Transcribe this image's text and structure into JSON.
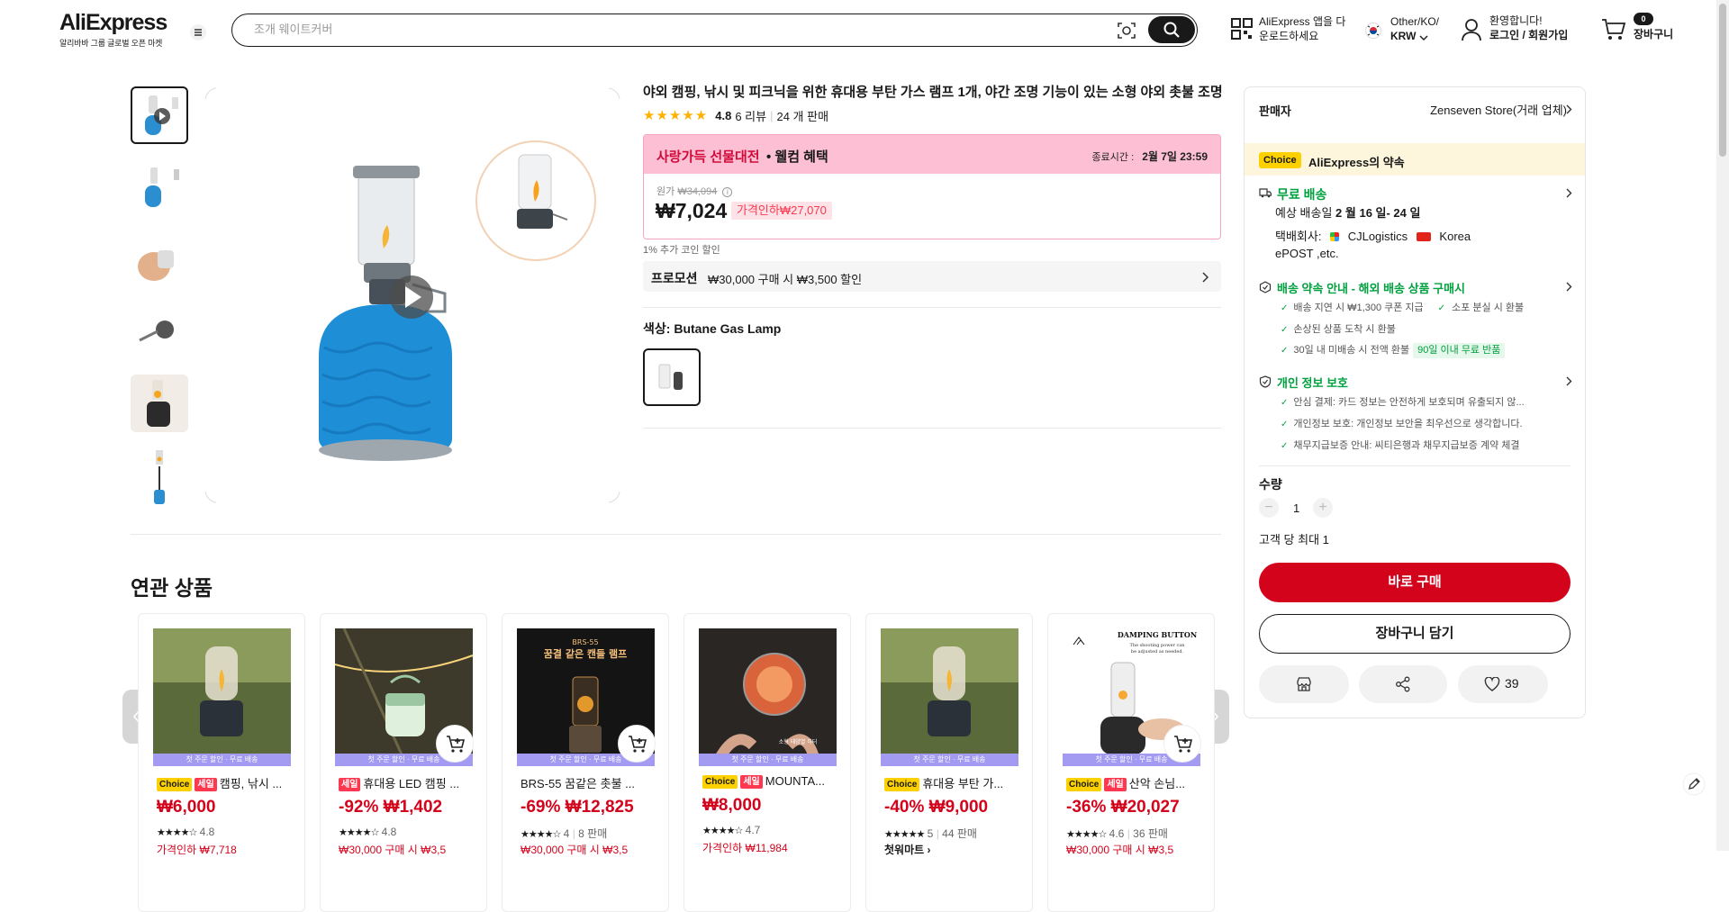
{
  "header": {
    "logo_text": "AliExpress",
    "logo_tagline": "알리바바 그룹 글로벌 오픈 마켓",
    "search_placeholder": "조개 웨이트커버",
    "app_line1": "AliExpress 앱을 다",
    "app_line2": "운로드하세요",
    "region_line1": "Other/KO/",
    "region_line2": "KRW",
    "welcome": "환영합니다!",
    "login": "로그인 / 회원가입",
    "cart_count": "0",
    "cart_label": "장바구니"
  },
  "product": {
    "title": "야외 캠핑, 낚시 및 피크닉을 위한 휴대용 부탄 가스 램프 1개, 야간 조명 기능이 있는 소형 야외 촛불 조명",
    "rating": "4.8",
    "reviews": "6 리뷰",
    "sold": "24 개 판매",
    "sale_name": "사랑가득 선물대전",
    "sale_suffix": "• 웰컴 혜택",
    "end_label": "종료시간 :",
    "end_time": "2월 7일 23:59",
    "original_label": "원가",
    "original_price": "₩34,094",
    "price": "₩7,024",
    "discount": "가격인하₩27,070",
    "coin": "1% 추가 코인 할인",
    "promo_name": "프로모션",
    "promo_text": "₩30,000 구매 시 ₩3,500 할인",
    "color_label": "색상:",
    "color_value": "Butane Gas Lamp"
  },
  "side": {
    "seller_label": "판매자",
    "seller_name": "Zenseven Store(거래 업체)",
    "choice_badge": "Choice",
    "choice_text": "AliExpress의 약속",
    "shipping_title": "무료 배송",
    "delivery_prefix": "예상 배송일",
    "delivery_date": "2 월 16 일- 24 일",
    "carrier_label": "택배회사:",
    "carrier1": "CJLogistics",
    "carrier2": "Korea",
    "carrier3": "ePOST ,etc.",
    "guarantee_title": "배송 약속 안내 - 해외 배송 상품 구매시",
    "g1": "배송 지연 시 ₩1,300 쿠폰 지급",
    "g2": "소포 분실 시 환불",
    "g3": "손상된 상품 도착 시 환불",
    "g4": "30일 내 미배송 시 전액 환불",
    "g4_tag": "90일 이내 무료 반품",
    "privacy_title": "개인 정보 보호",
    "p1": "안심 결제: 카드 정보는 안전하게 보호되며 유출되지 않...",
    "p2": "개인정보 보호: 개인정보 보안을 최우선으로 생각합니다.",
    "p3": "채무지급보증 안내: 씨티은행과 채무지급보증 계약 체결",
    "qty_label": "수량",
    "qty_value": "1",
    "qty_max": "고객 당 최대 1",
    "buy_now": "바로 구매",
    "add_cart": "장바구니 담기",
    "wish_count": "39"
  },
  "related": {
    "title": "연관 상품",
    "ribbon": "첫 주문 할인 · 무료 배송",
    "items": [
      {
        "choice": "Choice",
        "sale": "세일",
        "name": "캠핑, 낚시 ...",
        "price": "₩6,000",
        "stars": "★★★★☆",
        "rating": "4.8",
        "sold": "",
        "extra": "가격인하 ₩7,718"
      },
      {
        "choice": "",
        "sale": "세일",
        "name": "휴대용 LED 캠핑 ...",
        "price": "-92% ₩1,402",
        "stars": "★★★★☆",
        "rating": "4.8",
        "sold": "",
        "extra": "₩30,000 구매 시 ₩3,5"
      },
      {
        "choice": "",
        "sale": "",
        "name": "BRS-55 꿈같은 촛불 ...",
        "price": "-69% ₩12,825",
        "stars": "★★★★☆",
        "rating": "4",
        "sold": "8 판매",
        "extra": "₩30,000 구매 시 ₩3,5"
      },
      {
        "choice": "Choice",
        "sale": "세일",
        "name": "MOUNTA...",
        "price": "₩8,000",
        "stars": "★★★★☆",
        "rating": "4.7",
        "sold": "",
        "extra": "가격인하 ₩11,984"
      },
      {
        "choice": "Choice",
        "sale": "",
        "name": "휴대용 부탄 가...",
        "price": "-40% ₩9,000",
        "stars": "★★★★★",
        "rating": "5",
        "sold": "44 판매",
        "extra": "첫워마트 ›"
      },
      {
        "choice": "Choice",
        "sale": "세일",
        "name": "산악 손님...",
        "price": "-36% ₩20,027",
        "stars": "★★★★☆",
        "rating": "4.6",
        "sold": "36 판매",
        "extra": "₩30,000 구매 시 ₩3,5"
      }
    ],
    "image_texts": {
      "c3_line1": "BRS-55",
      "c3_line2": "꿈결 같은 캔들 램프",
      "c4_caption": "소형 태양열 히터",
      "c6_line1": "DAMPING BUTTON",
      "c6_line2": "The shooting power can",
      "c6_line3": "be adjusted as needed."
    }
  },
  "colors": {
    "accent_red": "#d3031c",
    "green": "#00a13f",
    "pink_banner": "#fdbfd3",
    "choice_yellow": "#fdd100"
  }
}
